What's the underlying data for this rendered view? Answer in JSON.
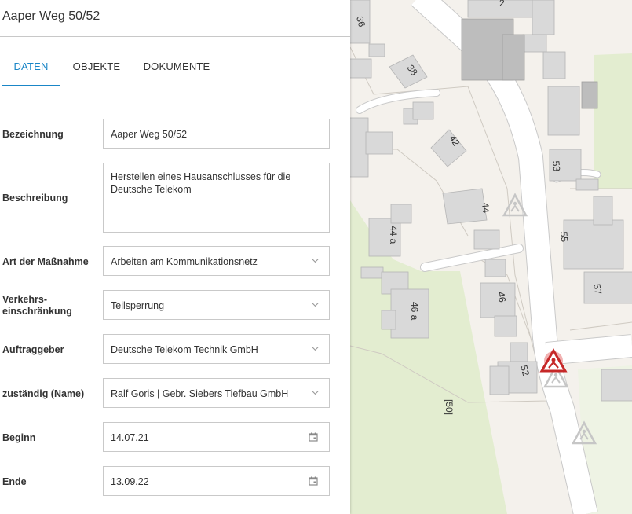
{
  "header": {
    "title": "Aaper Weg 50/52"
  },
  "tabs": [
    {
      "label": "DATEN",
      "active": true
    },
    {
      "label": "OBJEKTE",
      "active": false
    },
    {
      "label": "DOKUMENTE",
      "active": false
    }
  ],
  "form": {
    "bezeichnung": {
      "label": "Bezeichnung",
      "value": "Aaper Weg 50/52"
    },
    "beschreibung": {
      "label": "Beschreibung",
      "value": "Herstellen eines Hausanschlusses für die Deutsche Telekom"
    },
    "art": {
      "label": "Art der Maßnahme",
      "value": "Arbeiten am Kommunikationsnetz"
    },
    "verkehr": {
      "label_line1": "Verkehrs-",
      "label_line2": "einschränkung",
      "value": "Teilsperrung"
    },
    "auftraggeber": {
      "label": "Auftraggeber",
      "value": "Deutsche Telekom Technik GmbH"
    },
    "zustaendig": {
      "label": "zuständig (Name)",
      "value": "Ralf Goris | Gebr. Siebers Tiefbau GmbH"
    },
    "beginn": {
      "label": "Beginn",
      "value": "14.07.21"
    },
    "ende": {
      "label": "Ende",
      "value": "13.09.22"
    }
  },
  "map": {
    "house_numbers": [
      "2",
      "36",
      "38",
      "42",
      "44",
      "44 a",
      "46",
      "46 a",
      "52",
      "53",
      "55",
      "57",
      "[50]"
    ],
    "colors": {
      "background": "#f4f1ec",
      "green": "#e3edd0",
      "building": "#d9d9d9",
      "building_dark": "#b9b9b9",
      "road": "#ffffff",
      "road_edge": "#c9c9c9",
      "marker_active": "#c62828",
      "accent": "#1a86c7"
    }
  }
}
